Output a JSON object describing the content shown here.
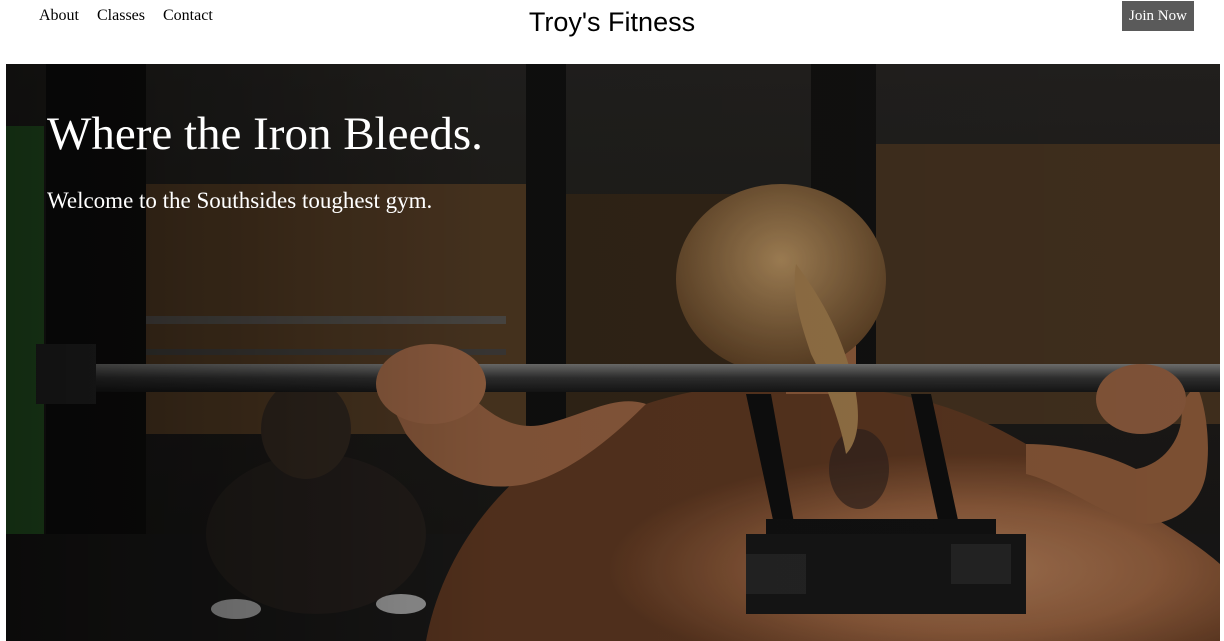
{
  "nav": {
    "items": [
      {
        "label": "About"
      },
      {
        "label": "Classes"
      },
      {
        "label": "Contact"
      }
    ]
  },
  "brand": {
    "title": "Troy's Fitness"
  },
  "header": {
    "join_label": "Join Now"
  },
  "hero": {
    "title": "Where the Iron Bleeds.",
    "subtitle": "Welcome to the Southsides toughest gym.",
    "image": "woman-barbell-squat-photo"
  },
  "colors": {
    "button_bg": "#5a5a5a",
    "hero_text": "#ffffff",
    "header_bg": "#ffffff"
  }
}
